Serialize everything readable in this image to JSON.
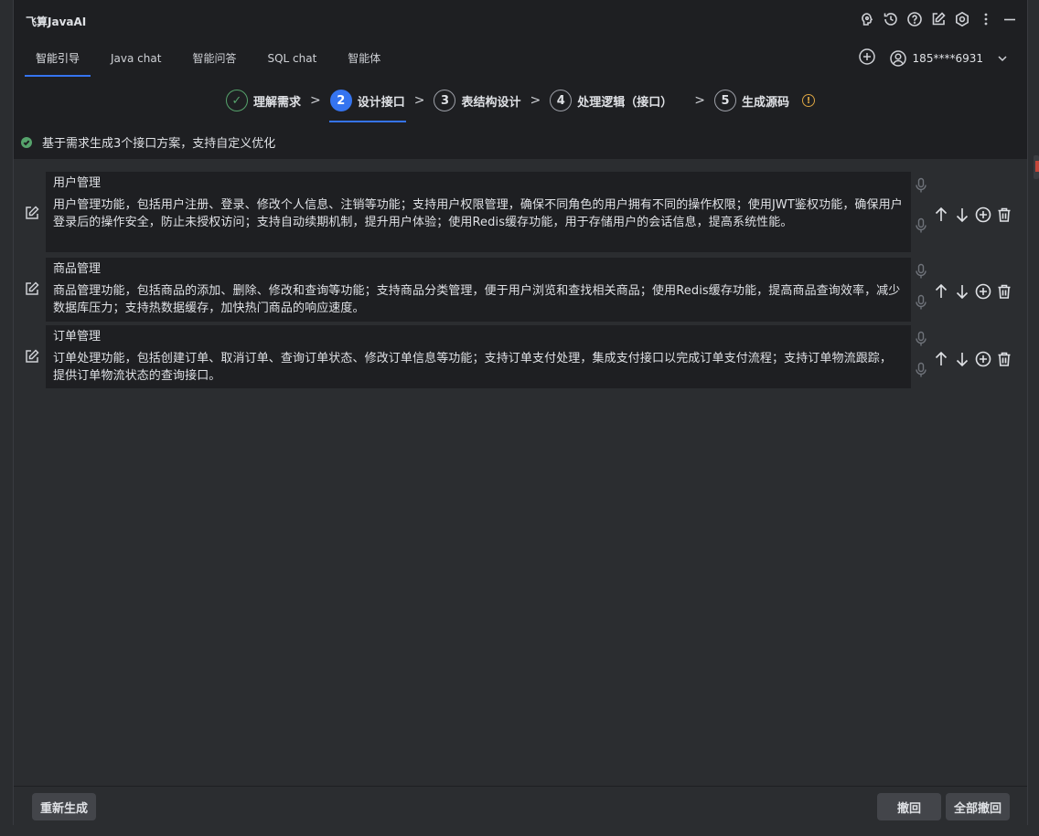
{
  "app": {
    "title": "飞算JavaAI"
  },
  "tabs": [
    {
      "label": "智能引导",
      "active": true
    },
    {
      "label": "Java chat",
      "active": false
    },
    {
      "label": "智能问答",
      "active": false
    },
    {
      "label": "SQL chat",
      "active": false
    },
    {
      "label": "智能体",
      "active": false
    }
  ],
  "user": {
    "phone": "185****6931"
  },
  "steps": [
    {
      "num": "✓",
      "label": "理解需求",
      "state": "done"
    },
    {
      "num": "2",
      "label": "设计接口",
      "state": "current"
    },
    {
      "num": "3",
      "label": "表结构设计",
      "state": "todo"
    },
    {
      "num": "4",
      "label": "处理逻辑（接口）",
      "state": "todo"
    },
    {
      "num": "5",
      "label": "生成源码",
      "state": "todo"
    }
  ],
  "status": {
    "message": "基于需求生成3个接口方案，支持自定义优化"
  },
  "interfaces": [
    {
      "title": "用户管理",
      "description": "用户管理功能，包括用户注册、登录、修改个人信息、注销等功能；支持用户权限管理，确保不同角色的用户拥有不同的操作权限；使用JWT鉴权功能，确保用户登录后的操作安全，防止未授权访问；支持自动续期机制，提升用户体验；使用Redis缓存功能，用于存储用户的会话信息，提高系统性能。"
    },
    {
      "title": "商品管理",
      "description": "商品管理功能，包括商品的添加、删除、修改和查询等功能；支持商品分类管理，便于用户浏览和查找相关商品；使用Redis缓存功能，提高商品查询效率，减少数据库压力；支持热数据缓存，加快热门商品的响应速度。"
    },
    {
      "title": "订单管理",
      "description": "订单处理功能，包括创建订单、取消订单、查询订单状态、修改订单信息等功能；支持订单支付处理，集成支付接口以完成订单支付流程；支持订单物流跟踪，提供订单物流状态的查询接口。"
    }
  ],
  "footer": {
    "regenerate": "重新生成",
    "undo": "撤回",
    "undo_all": "全部撤回"
  },
  "colors": {
    "accent": "#3574f0",
    "success": "#56a36c",
    "warning": "#d9a343"
  }
}
